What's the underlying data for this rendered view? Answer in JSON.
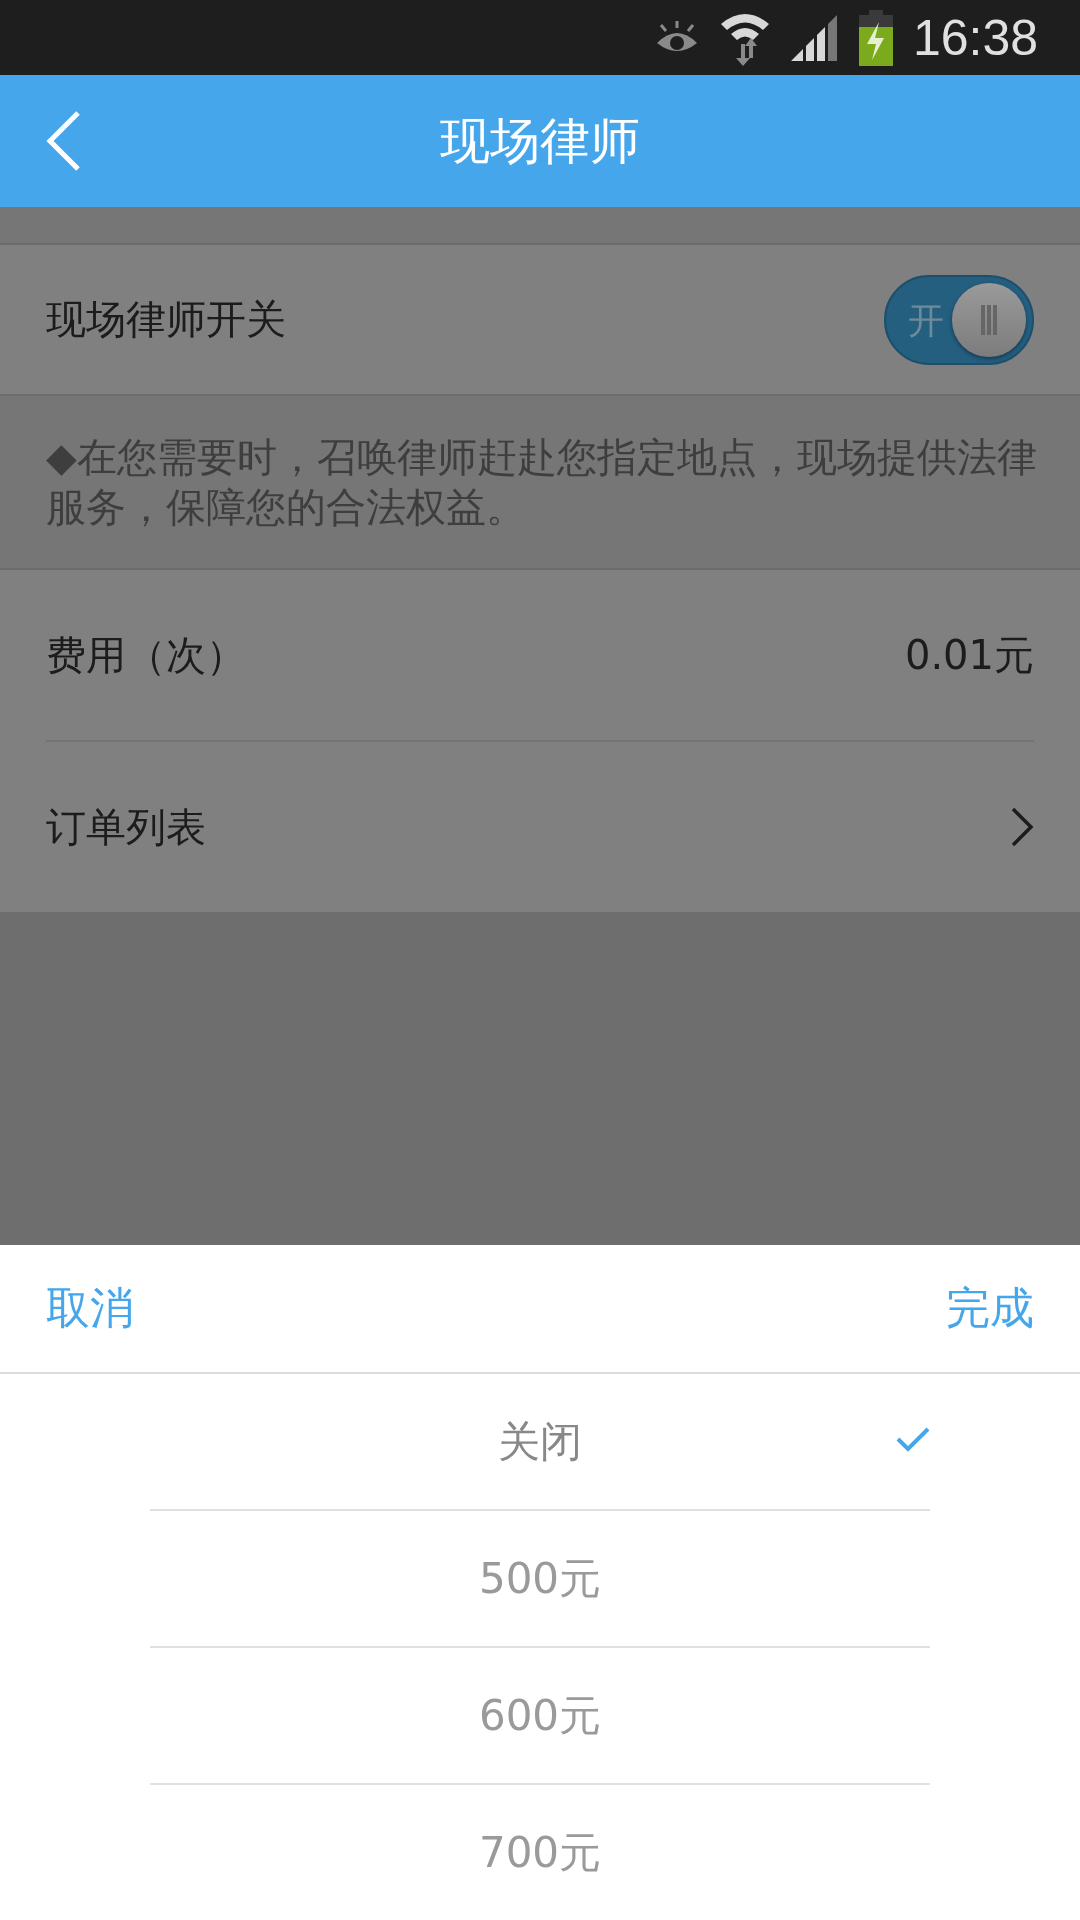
{
  "status_bar": {
    "time": "16:38"
  },
  "header": {
    "title": "现场律师"
  },
  "switch_row": {
    "label": "现场律师开关",
    "toggle_label": "开",
    "on": true
  },
  "description": "◆在您需要时，召唤律师赶赴您指定地点，现场提供法律服务，保障您的合法权益。",
  "fee_row": {
    "label": "费用（次）",
    "value": "0.01元"
  },
  "orders_row": {
    "label": "订单列表"
  },
  "picker": {
    "cancel": "取消",
    "done": "完成",
    "options": [
      {
        "label": "关闭",
        "selected": true
      },
      {
        "label": "500元",
        "selected": false
      },
      {
        "label": "600元",
        "selected": false
      },
      {
        "label": "700元",
        "selected": false
      }
    ]
  }
}
